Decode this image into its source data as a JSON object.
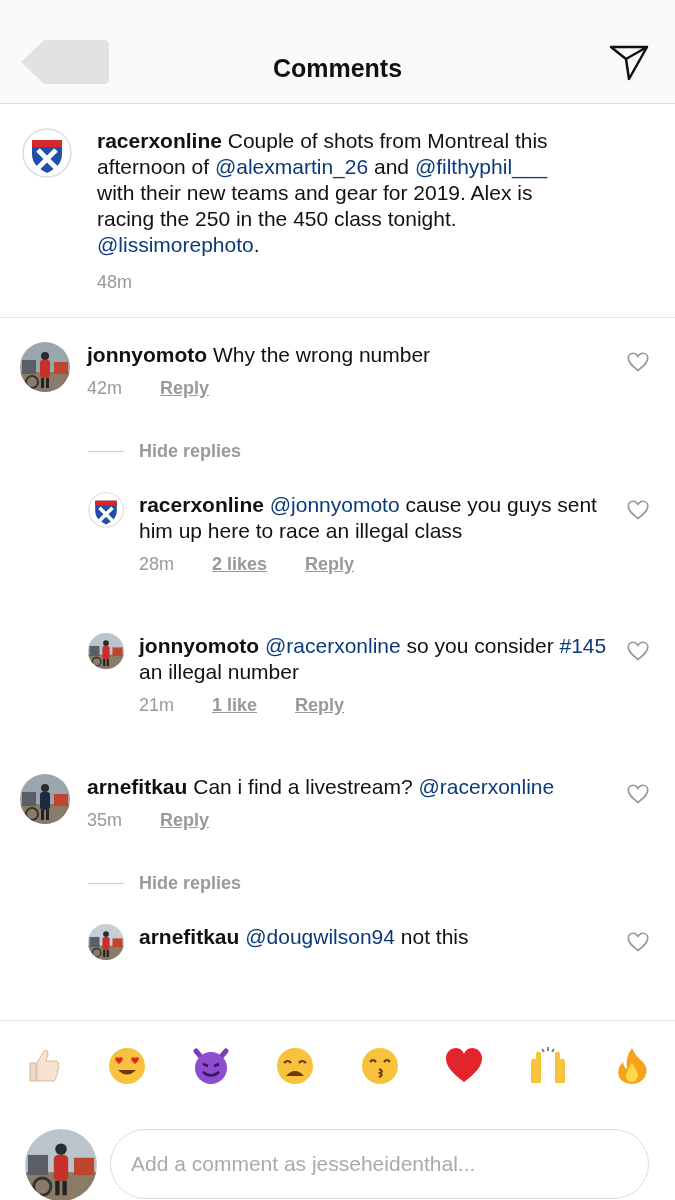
{
  "header": {
    "title": "Comments"
  },
  "post": {
    "avatar": {
      "kind": "logo"
    },
    "username": "racerxonline",
    "body": [
      {
        "kind": "text",
        "t": "Couple of shots from Montreal this afternoon of "
      },
      {
        "kind": "mention",
        "t": "@alexmartin_26"
      },
      {
        "kind": "text",
        "t": " and "
      },
      {
        "kind": "mention",
        "t": "@filthyphil___"
      },
      {
        "kind": "text",
        "t": " with their new teams and gear for 2019. Alex is racing the 250 in the 450 class tonight. "
      },
      {
        "kind": "mention",
        "t": "@lissimorephoto"
      },
      {
        "kind": "text",
        "t": "."
      }
    ],
    "time": "48m"
  },
  "comments": [
    {
      "avatar": {
        "kind": "picture"
      },
      "username": "jonnyomoto",
      "body": [
        {
          "kind": "text",
          "t": "Why the wrong number"
        }
      ],
      "time": "42m",
      "reply": "Reply",
      "liked": false,
      "replies_toggle": "Hide replies",
      "replies": [
        {
          "avatar": {
            "kind": "logo"
          },
          "username": "racerxonline",
          "body": [
            {
              "kind": "mention",
              "t": "@jonnyomoto"
            },
            {
              "kind": "text",
              "t": " cause you guys sent him up here to race an illegal class"
            }
          ],
          "time": "28m",
          "likes": "2 likes",
          "reply": "Reply",
          "liked": false
        },
        {
          "avatar": {
            "kind": "picture"
          },
          "username": "jonnyomoto",
          "body": [
            {
              "kind": "mention",
              "t": "@racerxonline"
            },
            {
              "kind": "text",
              "t": " so you consider "
            },
            {
              "kind": "hashtag",
              "t": "#145"
            },
            {
              "kind": "text",
              "t": " an illegal number"
            }
          ],
          "time": "21m",
          "likes": "1 like",
          "reply": "Reply",
          "liked": false
        }
      ]
    },
    {
      "avatar": {
        "kind": "picture"
      },
      "username": "arnefitkau",
      "body": [
        {
          "kind": "text",
          "t": "Can i find a livestream? "
        },
        {
          "kind": "mention",
          "t": "@racerxonline"
        }
      ],
      "time": "35m",
      "reply": "Reply",
      "liked": false,
      "replies_toggle": "Hide replies",
      "replies": [
        {
          "avatar": {
            "kind": "picture"
          },
          "username": "arnefitkau",
          "body": [
            {
              "kind": "mention",
              "t": "@dougwilson94"
            },
            {
              "kind": "text",
              "t": " not this"
            }
          ],
          "liked": false
        }
      ]
    }
  ],
  "emoji_bar": [
    {
      "kind": "thumbs_up"
    },
    {
      "kind": "heart_eyes"
    },
    {
      "kind": "devil"
    },
    {
      "kind": "weary"
    },
    {
      "kind": "kissing"
    },
    {
      "kind": "heart"
    },
    {
      "kind": "raised_hands"
    },
    {
      "kind": "fire"
    }
  ],
  "composer": {
    "avatar": {
      "kind": "picture"
    },
    "placeholder": "Add a comment as jesseheidenthal..."
  }
}
